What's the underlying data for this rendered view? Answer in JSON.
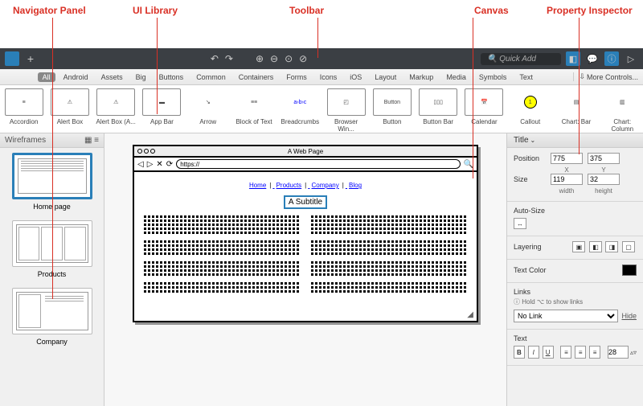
{
  "annotations": {
    "navigator": "Navigator Panel",
    "library": "UI Library",
    "toolbar": "Toolbar",
    "canvas": "Canvas",
    "inspector": "Property Inspector"
  },
  "topbar": {
    "quickadd_placeholder": "Quick Add",
    "undo_icon": "↶",
    "redo_icon": "↷"
  },
  "library_tabs": [
    "All",
    "Android",
    "Assets",
    "Big",
    "Buttons",
    "Common",
    "Containers",
    "Forms",
    "Icons",
    "iOS",
    "Layout",
    "Markup",
    "Media",
    "Symbols",
    "Text"
  ],
  "library_more": "More Controls...",
  "library_items": [
    {
      "name": "Accordion"
    },
    {
      "name": "Alert Box"
    },
    {
      "name": "Alert Box (A..."
    },
    {
      "name": "App Bar"
    },
    {
      "name": "Arrow"
    },
    {
      "name": "Block of Text"
    },
    {
      "name": "Breadcrumbs"
    },
    {
      "name": "Browser Win..."
    },
    {
      "name": "Button"
    },
    {
      "name": "Button Bar"
    },
    {
      "name": "Calendar"
    },
    {
      "name": "Callout"
    },
    {
      "name": "Chart: Bar"
    },
    {
      "name": "Chart: Column"
    }
  ],
  "navigator": {
    "title": "Wireframes",
    "items": [
      "Home page",
      "Products",
      "Company"
    ]
  },
  "canvas": {
    "browser_title": "A Web Page",
    "url_prefix": "https://",
    "nav_links": [
      "Home",
      "Products",
      "Company",
      "Blog"
    ],
    "subtitle": "A Subtitle"
  },
  "inspector": {
    "title": "Title",
    "position_label": "Position",
    "position_x": "775",
    "position_y": "375",
    "x_label": "X",
    "y_label": "Y",
    "size_label": "Size",
    "size_w": "119",
    "size_h": "32",
    "width_label": "width",
    "height_label": "height",
    "autosize_label": "Auto-Size",
    "layering_label": "Layering",
    "textcolor_label": "Text Color",
    "links_label": "Links",
    "links_hint": "Hold ⌥ to show links",
    "link_value": "No Link",
    "hide_label": "Hide",
    "text_label": "Text",
    "font_size": "28"
  }
}
